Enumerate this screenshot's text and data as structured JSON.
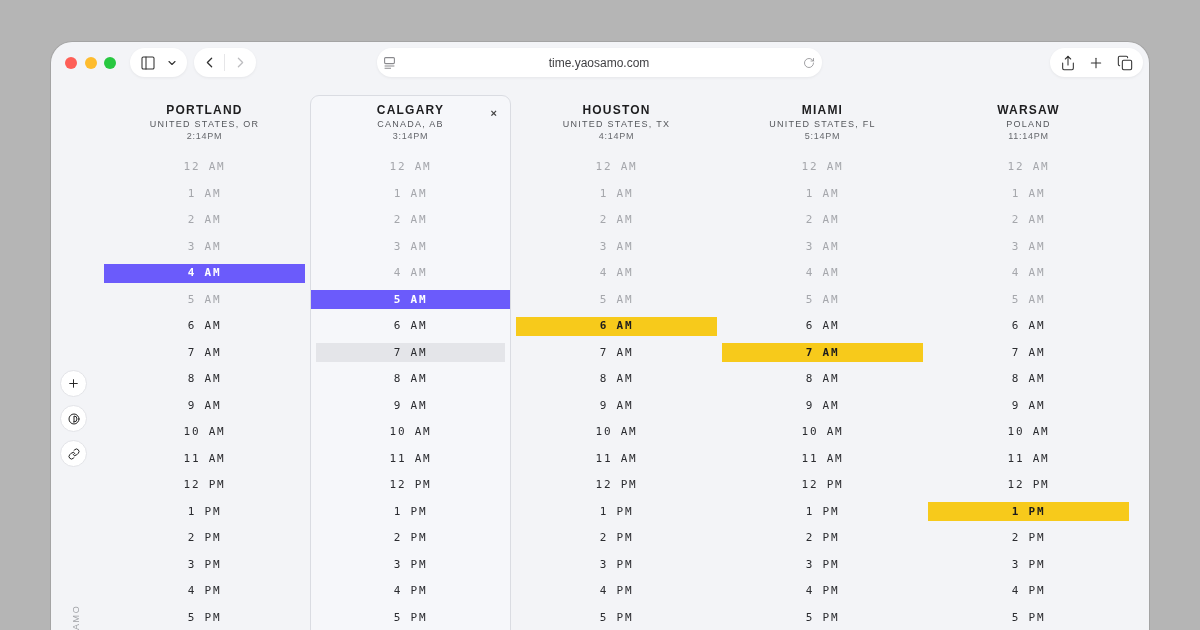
{
  "browser": {
    "url": "time.yaosamo.com",
    "forward_disabled": true
  },
  "side_label": "AMO",
  "columns": [
    {
      "city": "PORTLAND",
      "region": "UNITED STATES, OR",
      "time": "2:14PM",
      "selected": false,
      "color": "#6b5bfb",
      "hours": [
        {
          "label": "12 AM",
          "dimmed": true,
          "selected": false,
          "hovered": false
        },
        {
          "label": "1 AM",
          "dimmed": true,
          "selected": false,
          "hovered": false
        },
        {
          "label": "2 AM",
          "dimmed": true,
          "selected": false,
          "hovered": false
        },
        {
          "label": "3 AM",
          "dimmed": true,
          "selected": false,
          "hovered": false
        },
        {
          "label": "4 AM",
          "dimmed": false,
          "selected": true,
          "hovered": false
        },
        {
          "label": "5 AM",
          "dimmed": true,
          "selected": false,
          "hovered": false
        },
        {
          "label": "6 AM",
          "dimmed": false,
          "selected": false,
          "hovered": false
        },
        {
          "label": "7 AM",
          "dimmed": false,
          "selected": false,
          "hovered": false
        },
        {
          "label": "8 AM",
          "dimmed": false,
          "selected": false,
          "hovered": false
        },
        {
          "label": "9 AM",
          "dimmed": false,
          "selected": false,
          "hovered": false
        },
        {
          "label": "10 AM",
          "dimmed": false,
          "selected": false,
          "hovered": false
        },
        {
          "label": "11 AM",
          "dimmed": false,
          "selected": false,
          "hovered": false
        },
        {
          "label": "12 PM",
          "dimmed": false,
          "selected": false,
          "hovered": false
        },
        {
          "label": "1 PM",
          "dimmed": false,
          "selected": false,
          "hovered": false
        },
        {
          "label": "2 PM",
          "dimmed": false,
          "selected": false,
          "hovered": false
        },
        {
          "label": "3 PM",
          "dimmed": false,
          "selected": false,
          "hovered": false
        },
        {
          "label": "4 PM",
          "dimmed": false,
          "selected": false,
          "hovered": false
        },
        {
          "label": "5 PM",
          "dimmed": false,
          "selected": false,
          "hovered": false
        }
      ]
    },
    {
      "city": "CALGARY",
      "region": "CANADA, AB",
      "time": "3:14PM",
      "selected": true,
      "close": "×",
      "color": "#6b5bfb",
      "hours": [
        {
          "label": "12 AM",
          "dimmed": true,
          "selected": false,
          "hovered": false
        },
        {
          "label": "1 AM",
          "dimmed": true,
          "selected": false,
          "hovered": false
        },
        {
          "label": "2 AM",
          "dimmed": true,
          "selected": false,
          "hovered": false
        },
        {
          "label": "3 AM",
          "dimmed": true,
          "selected": false,
          "hovered": false
        },
        {
          "label": "4 AM",
          "dimmed": true,
          "selected": false,
          "hovered": false
        },
        {
          "label": "5 AM",
          "dimmed": false,
          "selected": true,
          "hovered": false
        },
        {
          "label": "6 AM",
          "dimmed": false,
          "selected": false,
          "hovered": false
        },
        {
          "label": "7 AM",
          "dimmed": false,
          "selected": false,
          "hovered": true
        },
        {
          "label": "8 AM",
          "dimmed": false,
          "selected": false,
          "hovered": false
        },
        {
          "label": "9 AM",
          "dimmed": false,
          "selected": false,
          "hovered": false
        },
        {
          "label": "10 AM",
          "dimmed": false,
          "selected": false,
          "hovered": false
        },
        {
          "label": "11 AM",
          "dimmed": false,
          "selected": false,
          "hovered": false
        },
        {
          "label": "12 PM",
          "dimmed": false,
          "selected": false,
          "hovered": false
        },
        {
          "label": "1 PM",
          "dimmed": false,
          "selected": false,
          "hovered": false
        },
        {
          "label": "2 PM",
          "dimmed": false,
          "selected": false,
          "hovered": false
        },
        {
          "label": "3 PM",
          "dimmed": false,
          "selected": false,
          "hovered": false
        },
        {
          "label": "4 PM",
          "dimmed": false,
          "selected": false,
          "hovered": false
        },
        {
          "label": "5 PM",
          "dimmed": false,
          "selected": false,
          "hovered": false
        }
      ]
    },
    {
      "city": "HOUSTON",
      "region": "UNITED STATES, TX",
      "time": "4:14PM",
      "selected": false,
      "color": "#f7ca1b",
      "hours": [
        {
          "label": "12 AM",
          "dimmed": true,
          "selected": false,
          "hovered": false
        },
        {
          "label": "1 AM",
          "dimmed": true,
          "selected": false,
          "hovered": false
        },
        {
          "label": "2 AM",
          "dimmed": true,
          "selected": false,
          "hovered": false
        },
        {
          "label": "3 AM",
          "dimmed": true,
          "selected": false,
          "hovered": false
        },
        {
          "label": "4 AM",
          "dimmed": true,
          "selected": false,
          "hovered": false
        },
        {
          "label": "5 AM",
          "dimmed": true,
          "selected": false,
          "hovered": false
        },
        {
          "label": "6 AM",
          "dimmed": false,
          "selected": true,
          "hovered": false
        },
        {
          "label": "7 AM",
          "dimmed": false,
          "selected": false,
          "hovered": false
        },
        {
          "label": "8 AM",
          "dimmed": false,
          "selected": false,
          "hovered": false
        },
        {
          "label": "9 AM",
          "dimmed": false,
          "selected": false,
          "hovered": false
        },
        {
          "label": "10 AM",
          "dimmed": false,
          "selected": false,
          "hovered": false
        },
        {
          "label": "11 AM",
          "dimmed": false,
          "selected": false,
          "hovered": false
        },
        {
          "label": "12 PM",
          "dimmed": false,
          "selected": false,
          "hovered": false
        },
        {
          "label": "1 PM",
          "dimmed": false,
          "selected": false,
          "hovered": false
        },
        {
          "label": "2 PM",
          "dimmed": false,
          "selected": false,
          "hovered": false
        },
        {
          "label": "3 PM",
          "dimmed": false,
          "selected": false,
          "hovered": false
        },
        {
          "label": "4 PM",
          "dimmed": false,
          "selected": false,
          "hovered": false
        },
        {
          "label": "5 PM",
          "dimmed": false,
          "selected": false,
          "hovered": false
        }
      ]
    },
    {
      "city": "MIAMI",
      "region": "UNITED STATES, FL",
      "time": "5:14PM",
      "selected": false,
      "color": "#f7ca1b",
      "hours": [
        {
          "label": "12 AM",
          "dimmed": true,
          "selected": false,
          "hovered": false
        },
        {
          "label": "1 AM",
          "dimmed": true,
          "selected": false,
          "hovered": false
        },
        {
          "label": "2 AM",
          "dimmed": true,
          "selected": false,
          "hovered": false
        },
        {
          "label": "3 AM",
          "dimmed": true,
          "selected": false,
          "hovered": false
        },
        {
          "label": "4 AM",
          "dimmed": true,
          "selected": false,
          "hovered": false
        },
        {
          "label": "5 AM",
          "dimmed": true,
          "selected": false,
          "hovered": false
        },
        {
          "label": "6 AM",
          "dimmed": false,
          "selected": false,
          "hovered": false
        },
        {
          "label": "7 AM",
          "dimmed": false,
          "selected": true,
          "hovered": false
        },
        {
          "label": "8 AM",
          "dimmed": false,
          "selected": false,
          "hovered": false
        },
        {
          "label": "9 AM",
          "dimmed": false,
          "selected": false,
          "hovered": false
        },
        {
          "label": "10 AM",
          "dimmed": false,
          "selected": false,
          "hovered": false
        },
        {
          "label": "11 AM",
          "dimmed": false,
          "selected": false,
          "hovered": false
        },
        {
          "label": "12 PM",
          "dimmed": false,
          "selected": false,
          "hovered": false
        },
        {
          "label": "1 PM",
          "dimmed": false,
          "selected": false,
          "hovered": false
        },
        {
          "label": "2 PM",
          "dimmed": false,
          "selected": false,
          "hovered": false
        },
        {
          "label": "3 PM",
          "dimmed": false,
          "selected": false,
          "hovered": false
        },
        {
          "label": "4 PM",
          "dimmed": false,
          "selected": false,
          "hovered": false
        },
        {
          "label": "5 PM",
          "dimmed": false,
          "selected": false,
          "hovered": false
        }
      ]
    },
    {
      "city": "WARSAW",
      "region": "POLAND",
      "time": "11:14PM",
      "selected": false,
      "color": "#f7ca1b",
      "hours": [
        {
          "label": "12 AM",
          "dimmed": true,
          "selected": false,
          "hovered": false
        },
        {
          "label": "1 AM",
          "dimmed": true,
          "selected": false,
          "hovered": false
        },
        {
          "label": "2 AM",
          "dimmed": true,
          "selected": false,
          "hovered": false
        },
        {
          "label": "3 AM",
          "dimmed": true,
          "selected": false,
          "hovered": false
        },
        {
          "label": "4 AM",
          "dimmed": true,
          "selected": false,
          "hovered": false
        },
        {
          "label": "5 AM",
          "dimmed": true,
          "selected": false,
          "hovered": false
        },
        {
          "label": "6 AM",
          "dimmed": false,
          "selected": false,
          "hovered": false
        },
        {
          "label": "7 AM",
          "dimmed": false,
          "selected": false,
          "hovered": false
        },
        {
          "label": "8 AM",
          "dimmed": false,
          "selected": false,
          "hovered": false
        },
        {
          "label": "9 AM",
          "dimmed": false,
          "selected": false,
          "hovered": false
        },
        {
          "label": "10 AM",
          "dimmed": false,
          "selected": false,
          "hovered": false
        },
        {
          "label": "11 AM",
          "dimmed": false,
          "selected": false,
          "hovered": false
        },
        {
          "label": "12 PM",
          "dimmed": false,
          "selected": false,
          "hovered": false
        },
        {
          "label": "1 PM",
          "dimmed": false,
          "selected": true,
          "hovered": false
        },
        {
          "label": "2 PM",
          "dimmed": false,
          "selected": false,
          "hovered": false
        },
        {
          "label": "3 PM",
          "dimmed": false,
          "selected": false,
          "hovered": false
        },
        {
          "label": "4 PM",
          "dimmed": false,
          "selected": false,
          "hovered": false
        },
        {
          "label": "5 PM",
          "dimmed": false,
          "selected": false,
          "hovered": false
        }
      ]
    }
  ]
}
